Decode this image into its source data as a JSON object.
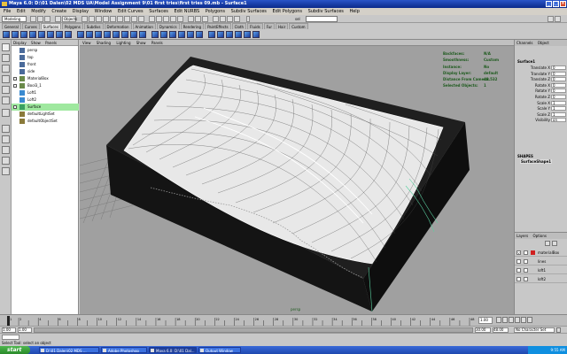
{
  "window": {
    "title": "Maya 6.0: D:\\01 Dalen\\02 MDS UA\\Model Assignment 9\\01 first tries\\first tries 09.mb  -  Surface1"
  },
  "menubar": {
    "items": [
      "File",
      "Edit",
      "Modify",
      "Create",
      "Display",
      "Window",
      "Edit Curves",
      "Surfaces",
      "Edit NURBS",
      "Polygons",
      "Subdiv Surfaces",
      "Edit Polygons",
      "Subdiv Surfaces",
      "Help"
    ]
  },
  "statusline": {
    "mode": "Modeling",
    "field_label": "Objects",
    "selset_label": "sel"
  },
  "shelf": {
    "tabs": [
      "General",
      "Curves",
      "Surfaces",
      "Polygons",
      "Subdivs",
      "Deformation",
      "Animation",
      "Dynamics",
      "Rendering",
      "PaintEffects",
      "Cloth",
      "Fluids",
      "Fur",
      "Hair",
      "Custom"
    ],
    "active_tab": "Surfaces"
  },
  "outliner": {
    "menu": [
      "Display",
      "Show",
      "Panels"
    ],
    "items": [
      {
        "label": "persp",
        "icon": "camera-icon",
        "expand": false
      },
      {
        "label": "top",
        "icon": "camera-icon",
        "expand": false
      },
      {
        "label": "front",
        "icon": "camera-icon",
        "expand": false
      },
      {
        "label": "side",
        "icon": "camera-icon",
        "expand": false
      },
      {
        "label": "MaterialBox",
        "icon": "mesh-icon",
        "expand": true
      },
      {
        "label": "Bool3_1",
        "icon": "mesh-icon",
        "expand": true
      },
      {
        "label": "Loft1",
        "icon": "curve-icon",
        "expand": false
      },
      {
        "label": "Loft2",
        "icon": "curve-icon",
        "expand": false
      },
      {
        "label": "Surface",
        "icon": "surface-icon",
        "expand": true,
        "selected": true
      },
      {
        "label": "defaultLightSet",
        "icon": "set-icon",
        "expand": false
      },
      {
        "label": "defaultObjectSet",
        "icon": "set-icon",
        "expand": false
      }
    ]
  },
  "viewport": {
    "menu": [
      "View",
      "Shading",
      "Lighting",
      "Show",
      "Panels"
    ],
    "hud": [
      {
        "k": "Backfaces:",
        "v": "N/A"
      },
      {
        "k": "Smoothness:",
        "v": "Custom"
      },
      {
        "k": "Instance:",
        "v": "No"
      },
      {
        "k": "Display Layer:",
        "v": "default"
      },
      {
        "k": "Distance From Camera:",
        "v": "48.532"
      },
      {
        "k": "Selected Objects:",
        "v": "1"
      }
    ],
    "camera": "persp"
  },
  "channelbox": {
    "menu": [
      "Channels",
      "Object"
    ],
    "object": "Surface1",
    "channels": [
      {
        "k": "Translate X",
        "v": "0"
      },
      {
        "k": "Translate Y",
        "v": "0"
      },
      {
        "k": "Translate Z",
        "v": "0"
      },
      {
        "k": "Rotate X",
        "v": "0"
      },
      {
        "k": "Rotate Y",
        "v": "0"
      },
      {
        "k": "Rotate Z",
        "v": "0"
      },
      {
        "k": "Scale X",
        "v": "1"
      },
      {
        "k": "Scale Y",
        "v": "1"
      },
      {
        "k": "Scale Z",
        "v": "1"
      },
      {
        "k": "Visibility",
        "v": "on"
      }
    ],
    "shapes_label": "SHAPES",
    "shape_name": "SurfaceShape1"
  },
  "layers": {
    "menu": [
      "Layers",
      "Options"
    ],
    "rows": [
      {
        "v": "V",
        "color": "#d02020",
        "name": "materialBox"
      },
      {
        "v": "",
        "color": "#c8c8c8",
        "name": "lines"
      },
      {
        "v": "",
        "color": "#c8c8c8",
        "name": "loft1"
      },
      {
        "v": "",
        "color": "#c8c8c8",
        "name": "loft2"
      }
    ]
  },
  "timeline": {
    "ticks": [
      "1",
      "2",
      "4",
      "6",
      "8",
      "10",
      "12",
      "14",
      "16",
      "18",
      "20",
      "22",
      "24",
      "26",
      "28",
      "30",
      "32",
      "34",
      "36",
      "38",
      "40",
      "42",
      "44",
      "46",
      "48"
    ],
    "current": "1.00"
  },
  "range": {
    "start": "1.00",
    "inner_start": "1.00",
    "inner_end": "30.00",
    "end": "48.00",
    "character": "No Character Set"
  },
  "help": {
    "text": "Select Tool: select an object"
  },
  "taskbar": {
    "start": "start",
    "tasks": [
      {
        "label": "D:\\01 Dalen\\02 MDS ...",
        "active": false
      },
      {
        "label": "Adobe Photoshop",
        "active": false
      },
      {
        "label": "Maya 6.0: D:\\01 Dal...",
        "active": true
      },
      {
        "label": "Output Window",
        "active": false
      }
    ],
    "clock": "9:55 AM"
  },
  "colors": {
    "box": "#1a1a1a",
    "surface_wire": "#ffffff",
    "selection_highlight": "#9fe89f",
    "hud_text": "#1d5a1d"
  }
}
